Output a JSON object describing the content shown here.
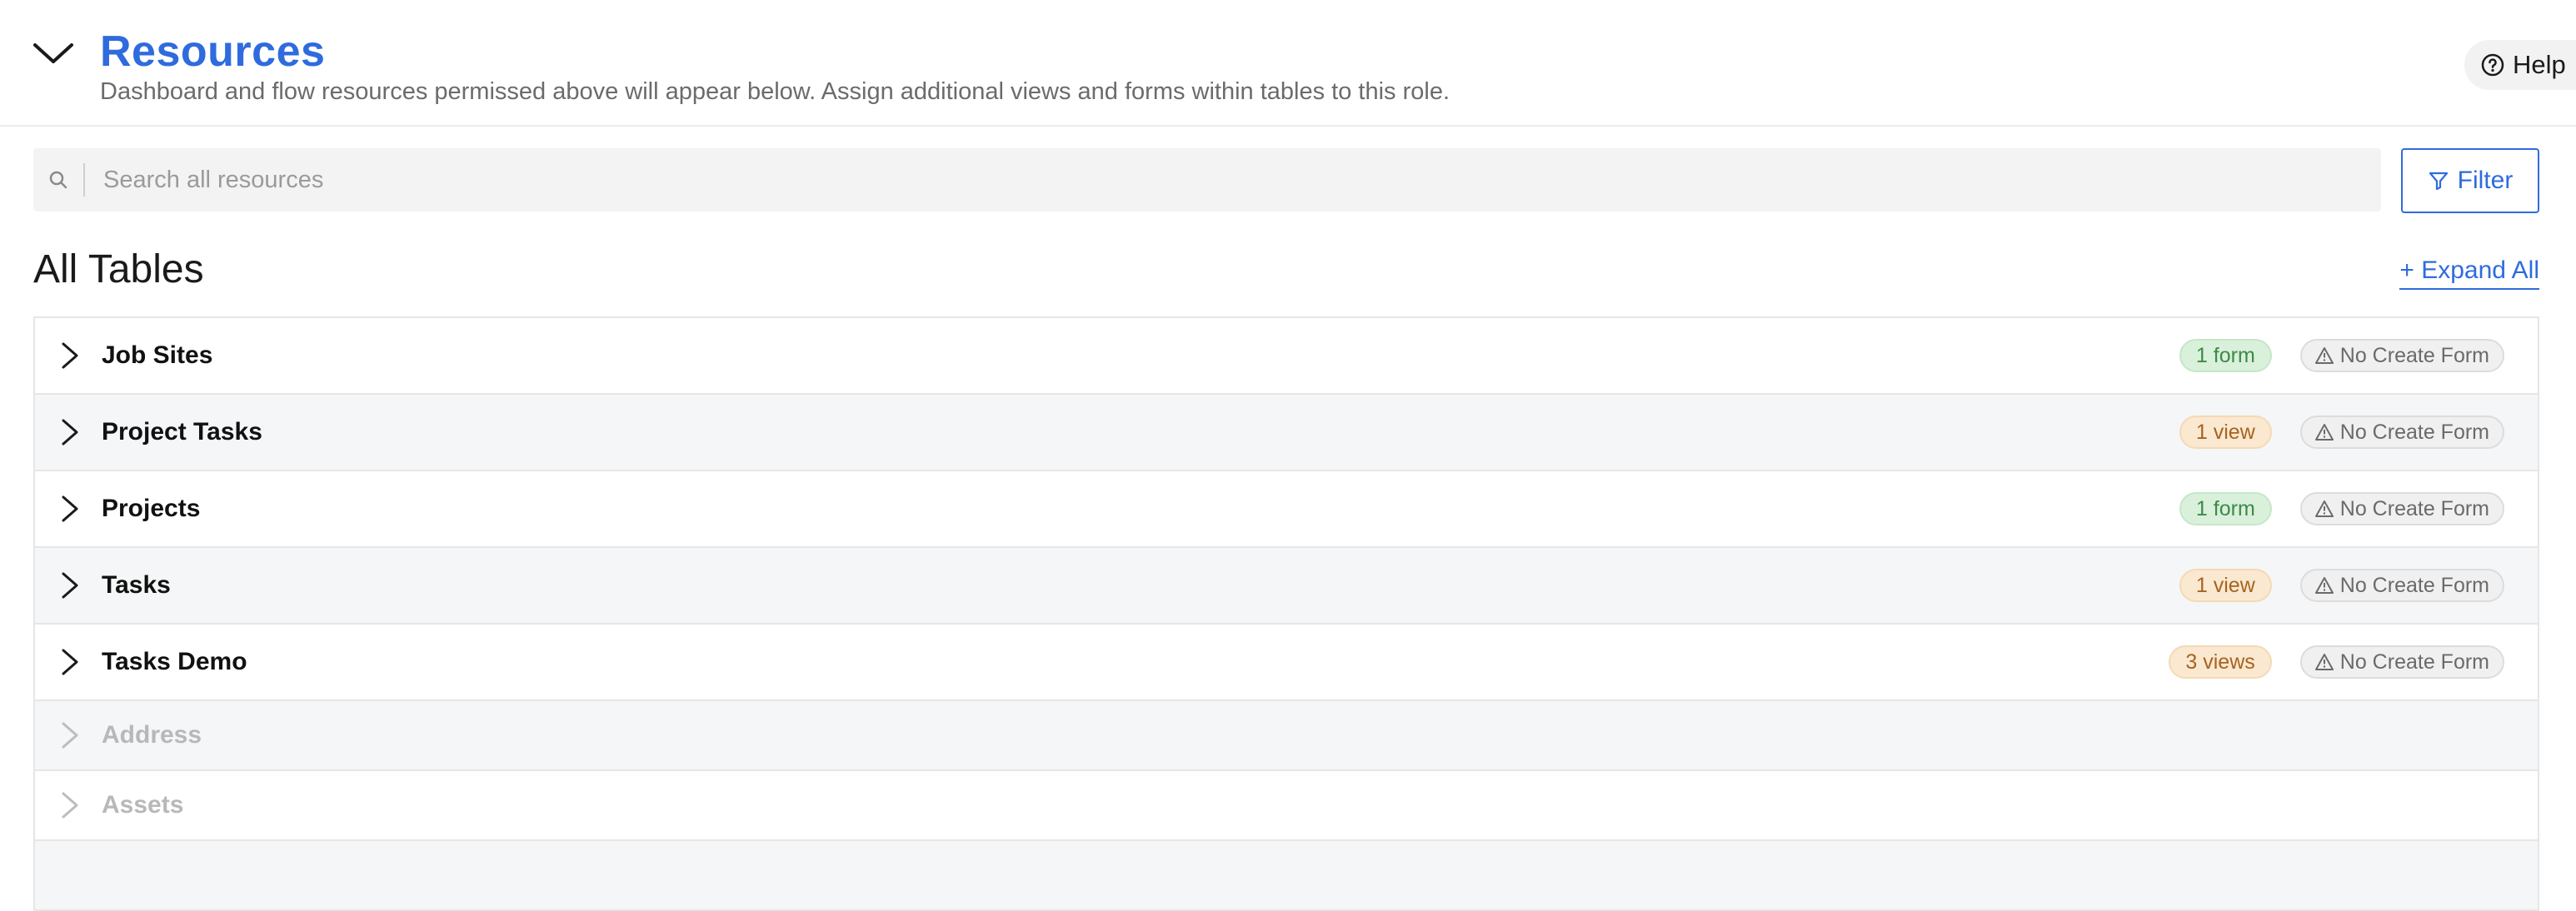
{
  "header": {
    "title": "Resources",
    "subtitle": "Dashboard and flow resources permissed above will appear below. Assign additional views and forms within tables to this role.",
    "help_label": "Help",
    "collapse_icon": "chevron-down-icon"
  },
  "search": {
    "placeholder": "Search all resources",
    "value": ""
  },
  "filter": {
    "label": "Filter"
  },
  "section": {
    "title": "All Tables",
    "expand_all_label": "+ Expand All"
  },
  "tables": [
    {
      "name": "Job Sites",
      "count_badge": "1 form",
      "badge_kind": "form",
      "warning": "No Create Form",
      "enabled": true
    },
    {
      "name": "Project Tasks",
      "count_badge": "1 view",
      "badge_kind": "view",
      "warning": "No Create Form",
      "enabled": true
    },
    {
      "name": "Projects",
      "count_badge": "1 form",
      "badge_kind": "form",
      "warning": "No Create Form",
      "enabled": true
    },
    {
      "name": "Tasks",
      "count_badge": "1 view",
      "badge_kind": "view",
      "warning": "No Create Form",
      "enabled": true
    },
    {
      "name": "Tasks Demo",
      "count_badge": "3 views",
      "badge_kind": "view",
      "warning": "No Create Form",
      "enabled": true
    },
    {
      "name": "Address",
      "enabled": false
    },
    {
      "name": "Assets",
      "enabled": false
    }
  ],
  "colors": {
    "accent": "#2f6bde",
    "form_badge_bg": "#d9f0db",
    "view_badge_bg": "#fbe8d0",
    "disabled_text": "#b8b8b8"
  }
}
